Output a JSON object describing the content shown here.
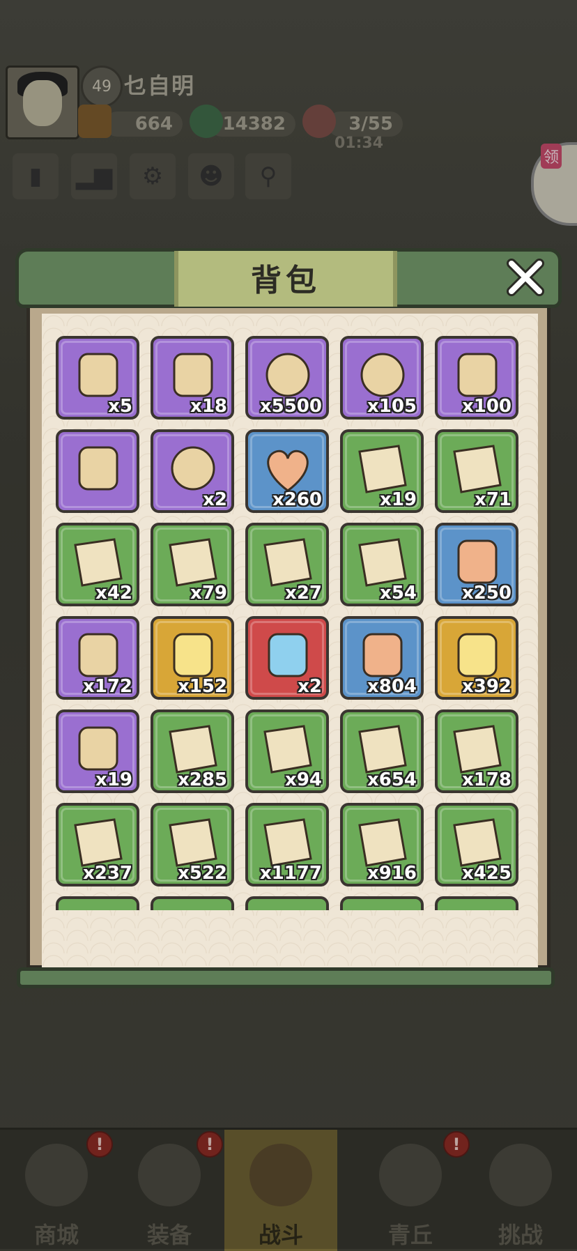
{
  "player": {
    "level": "49",
    "name": "乜自明"
  },
  "resources": [
    {
      "icon": "gold-ticket-icon",
      "value": "664"
    },
    {
      "icon": "green-dragon-coin-icon",
      "value": "14382"
    },
    {
      "icon": "peach-stamina-icon",
      "value": "3/55"
    }
  ],
  "stamina_timer": "01:34",
  "side_badge": "领",
  "modal": {
    "title": "背包",
    "close": "✕"
  },
  "colors": {
    "purple": "#9a6fd0",
    "green": "#6cab58",
    "blue": "#5c93c9",
    "gold": "#d8a637",
    "red": "#cf4a4a"
  },
  "items": [
    {
      "name": "golden-key-trophy",
      "rarity": "purple",
      "qty": "x5"
    },
    {
      "name": "paper-scroll",
      "rarity": "purple",
      "qty": "x18"
    },
    {
      "name": "gold-coin",
      "rarity": "purple",
      "qty": "x5500"
    },
    {
      "name": "silver-emblem",
      "rarity": "purple",
      "qty": "x105"
    },
    {
      "name": "tied-scroll",
      "rarity": "purple",
      "qty": "x100"
    },
    {
      "name": "blue-talisman",
      "rarity": "purple",
      "qty": ""
    },
    {
      "name": "red-command-token",
      "rarity": "purple",
      "qty": "x2"
    },
    {
      "name": "orange-heart",
      "rarity": "blue",
      "qty": "x260"
    },
    {
      "name": "sword-recipe-scroll",
      "rarity": "green",
      "qty": "x19"
    },
    {
      "name": "armor-recipe-scroll",
      "rarity": "green",
      "qty": "x71"
    },
    {
      "name": "helmet-recipe-scroll",
      "rarity": "green",
      "qty": "x42"
    },
    {
      "name": "bow-recipe-scroll",
      "rarity": "green",
      "qty": "x79"
    },
    {
      "name": "boot-recipe-scroll",
      "rarity": "green",
      "qty": "x27"
    },
    {
      "name": "ring-recipe-scroll",
      "rarity": "green",
      "qty": "x54"
    },
    {
      "name": "grey-crystal",
      "rarity": "blue",
      "qty": "x250"
    },
    {
      "name": "rainbow-crystals",
      "rarity": "purple",
      "qty": "x172"
    },
    {
      "name": "golden-dragon-shard",
      "rarity": "gold",
      "qty": "x152"
    },
    {
      "name": "blue-prayer-beads",
      "rarity": "red",
      "qty": "x2"
    },
    {
      "name": "meat-feast",
      "rarity": "blue",
      "qty": "x804"
    },
    {
      "name": "points-token",
      "rarity": "gold",
      "qty": "x392"
    },
    {
      "name": "fire-card",
      "rarity": "purple",
      "qty": "x19"
    },
    {
      "name": "eagle-skill-scroll",
      "rarity": "green",
      "qty": "x285"
    },
    {
      "name": "fireball-skill-scroll",
      "rarity": "green",
      "qty": "x94"
    },
    {
      "name": "snowball-skill-scroll",
      "rarity": "green",
      "qty": "x654"
    },
    {
      "name": "lightning-skill-scroll",
      "rarity": "green",
      "qty": "x178"
    },
    {
      "name": "wolf-skill-scroll",
      "rarity": "green",
      "qty": "x237"
    },
    {
      "name": "ghost-skill-scroll",
      "rarity": "green",
      "qty": "x522"
    },
    {
      "name": "dragon-skill-scroll",
      "rarity": "green",
      "qty": "x1177"
    },
    {
      "name": "wind-skill-scroll",
      "rarity": "green",
      "qty": "x916"
    },
    {
      "name": "slash-skill-scroll",
      "rarity": "green",
      "qty": "x425"
    }
  ],
  "nav": [
    {
      "label": "商城",
      "badge": "!"
    },
    {
      "label": "装备",
      "badge": "!"
    },
    {
      "label": "战斗",
      "badge": ""
    },
    {
      "label": "青丘",
      "badge": "!"
    },
    {
      "label": "挑战",
      "badge": ""
    }
  ]
}
